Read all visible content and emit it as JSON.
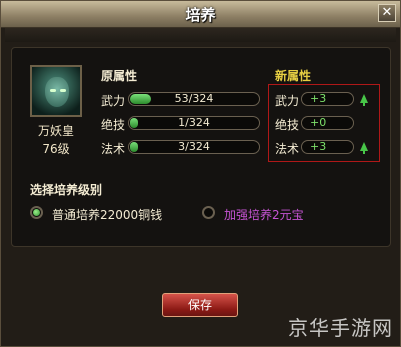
{
  "dialog": {
    "title": "培养",
    "close_glyph": "✕"
  },
  "hero": {
    "name": "万妖皇",
    "level": "76级",
    "portrait_icon": "hero-portrait-icon"
  },
  "original_attrs": {
    "heading": "原属性",
    "rows": [
      {
        "label": "武力",
        "value": "53/324",
        "current": 53,
        "max": 324
      },
      {
        "label": "绝技",
        "value": "1/324",
        "current": 1,
        "max": 324
      },
      {
        "label": "法术",
        "value": "3/324",
        "current": 3,
        "max": 324
      }
    ]
  },
  "new_attrs": {
    "heading": "新属性",
    "rows": [
      {
        "label": "武力",
        "delta": "+3",
        "arrow": "up-arrow-icon"
      },
      {
        "label": "绝技",
        "delta": "+0",
        "arrow": ""
      },
      {
        "label": "法术",
        "delta": "+3",
        "arrow": "up-arrow-icon"
      }
    ]
  },
  "training_level": {
    "heading": "选择培养级别",
    "options": [
      {
        "label": "普通培养22000铜钱",
        "selected": true,
        "color": "#f4ecd3"
      },
      {
        "label": "加强培养2元宝",
        "selected": false,
        "color": "#c654d4"
      }
    ]
  },
  "actions": {
    "save_label": "保存"
  },
  "watermark": "京华手游网",
  "colors": {
    "accent_green": "#48c648",
    "highlight_red": "#b01818",
    "new_heading": "#e7cf43"
  }
}
